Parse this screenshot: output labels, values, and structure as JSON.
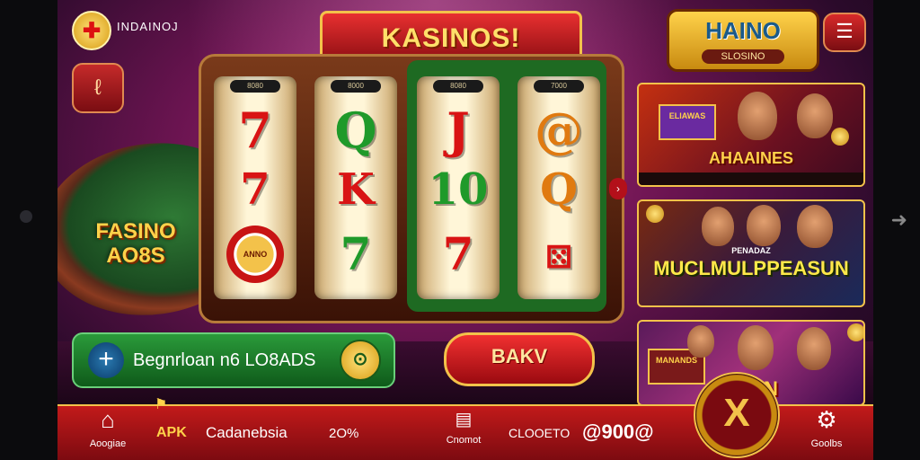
{
  "brand": {
    "logo_glyph": "✚",
    "name": "INDAINOJ"
  },
  "promo_icon_glyph": "ℓ",
  "title_banner": "KASINOS!",
  "table_label": "FASINO AO8S",
  "slot": {
    "reel_tags": [
      "8080",
      "8000",
      "8080",
      "7000"
    ],
    "reels": [
      [
        "7",
        "7",
        "chip"
      ],
      [
        "Q",
        "K",
        "7"
      ],
      [
        "J",
        "10",
        "7"
      ],
      [
        "@",
        "Q",
        "dice"
      ]
    ],
    "chip_text": "ANNO",
    "arrow_glyph": "›"
  },
  "right_logo": {
    "main": "HAINO",
    "sub": "SLOSINO"
  },
  "menu_glyph": "☰",
  "cards": [
    {
      "badge": "ELIAWAS",
      "title": "AHAAINES"
    },
    {
      "pretitle": "PENADAZ",
      "title": "MUCLMULPPEASUN"
    },
    {
      "badge": "MANANDS",
      "title": "DAIIN"
    }
  ],
  "login": {
    "plus": "+",
    "text": "Begnrloan n6 LO8ADS",
    "coin": "⊙"
  },
  "bank_button": "BAKV",
  "bottom_bar": {
    "left_label": "Aoogiae",
    "apk": "APK",
    "country": "Cadanebsia",
    "year": "2O%",
    "center_label": "Cnomot",
    "contact": "CLOOETO",
    "phone": "@900@",
    "coin_glyph": "X",
    "right_label": "Goolbs"
  }
}
